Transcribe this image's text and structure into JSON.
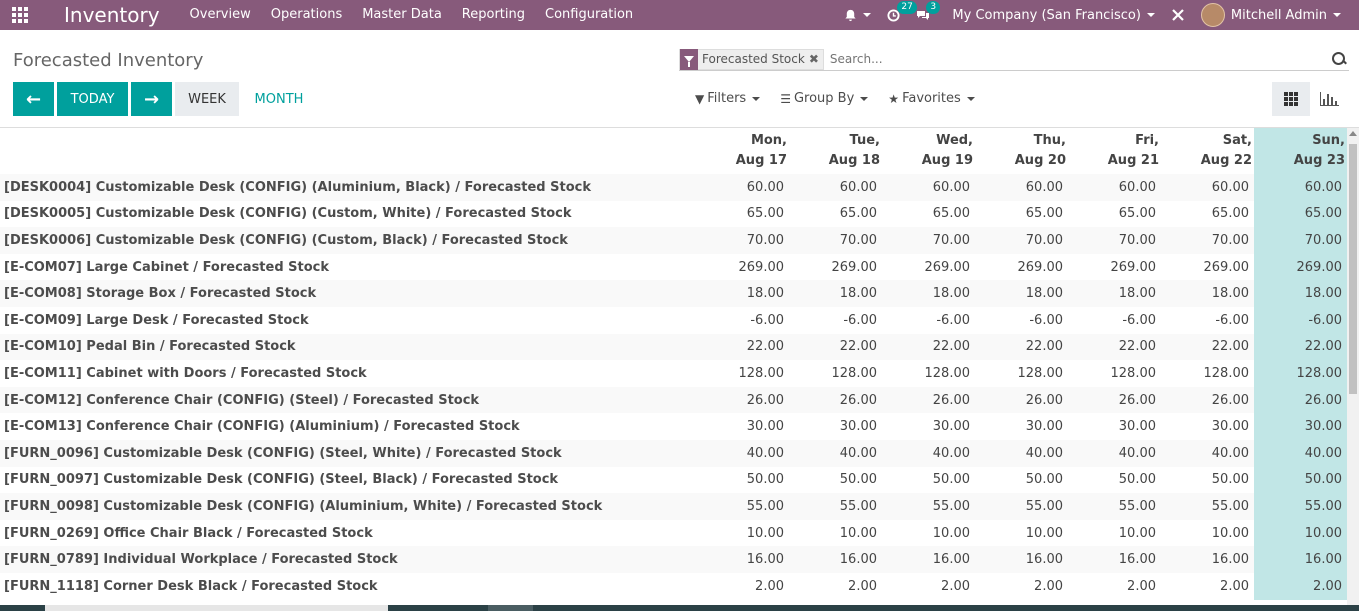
{
  "navbar": {
    "app_name": "Inventory",
    "menu": [
      "Overview",
      "Operations",
      "Master Data",
      "Reporting",
      "Configuration"
    ],
    "activity_count": "27",
    "messages_count": "3",
    "company": "My Company (San Francisco)",
    "user": "Mitchell Admin",
    "accent_color": "#875a7b"
  },
  "control_panel": {
    "title": "Forecasted Inventory",
    "facet_label": "Forecasted Stock",
    "search_placeholder": "Search...",
    "buttons": {
      "today": "TODAY",
      "week": "WEEK",
      "month": "MONTH",
      "prev": "←",
      "next": "→"
    },
    "filters_label": "Filters",
    "group_by_label": "Group By",
    "favorites_label": "Favorites",
    "primary_color": "#00a09d"
  },
  "table": {
    "columns": [
      {
        "day": "Mon,",
        "date": "Aug 17"
      },
      {
        "day": "Tue,",
        "date": "Aug 18"
      },
      {
        "day": "Wed,",
        "date": "Aug 19"
      },
      {
        "day": "Thu,",
        "date": "Aug 20"
      },
      {
        "day": "Fri,",
        "date": "Aug 21"
      },
      {
        "day": "Sat,",
        "date": "Aug 22"
      },
      {
        "day": "Sun,",
        "date": "Aug 23"
      }
    ],
    "rows": [
      {
        "name": "[DESK0004] Customizable Desk (CONFIG) (Aluminium, Black)  /  Forecasted Stock",
        "value": "60.00"
      },
      {
        "name": "[DESK0005] Customizable Desk (CONFIG) (Custom, White)  /  Forecasted Stock",
        "value": "65.00"
      },
      {
        "name": "[DESK0006] Customizable Desk (CONFIG) (Custom, Black)  /  Forecasted Stock",
        "value": "70.00"
      },
      {
        "name": "[E-COM07] Large Cabinet  /  Forecasted Stock",
        "value": "269.00"
      },
      {
        "name": "[E-COM08] Storage Box  /  Forecasted Stock",
        "value": "18.00"
      },
      {
        "name": "[E-COM09] Large Desk  /  Forecasted Stock",
        "value": "-6.00"
      },
      {
        "name": "[E-COM10] Pedal Bin  /  Forecasted Stock",
        "value": "22.00"
      },
      {
        "name": "[E-COM11] Cabinet with Doors  /  Forecasted Stock",
        "value": "128.00"
      },
      {
        "name": "[E-COM12] Conference Chair (CONFIG) (Steel)  /  Forecasted Stock",
        "value": "26.00"
      },
      {
        "name": "[E-COM13] Conference Chair (CONFIG) (Aluminium)  /  Forecasted Stock",
        "value": "30.00"
      },
      {
        "name": "[FURN_0096] Customizable Desk (CONFIG) (Steel, White)  /  Forecasted Stock",
        "value": "40.00"
      },
      {
        "name": "[FURN_0097] Customizable Desk (CONFIG) (Steel, Black)  /  Forecasted Stock",
        "value": "50.00"
      },
      {
        "name": "[FURN_0098] Customizable Desk (CONFIG) (Aluminium, White)  /  Forecasted Stock",
        "value": "55.00"
      },
      {
        "name": "[FURN_0269] Office Chair Black  /  Forecasted Stock",
        "value": "10.00"
      },
      {
        "name": "[FURN_0789] Individual Workplace  /  Forecasted Stock",
        "value": "16.00"
      },
      {
        "name": "[FURN_1118] Corner Desk Black  /  Forecasted Stock",
        "value": "2.00"
      }
    ],
    "today_column_color": "#c1e6e6"
  }
}
